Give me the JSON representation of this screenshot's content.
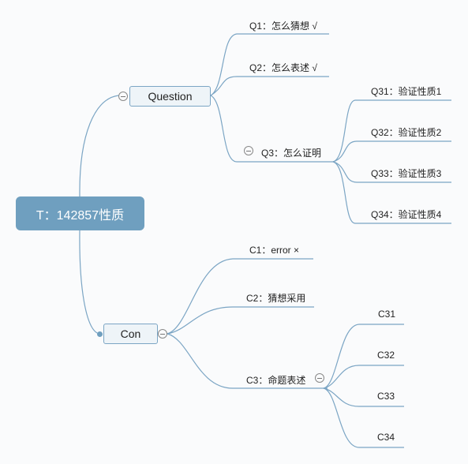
{
  "colors": {
    "line": "#7ba5c4",
    "root_fill": "#6f9fbf",
    "root_text": "#ffffff",
    "node_fill": "#eef4f8",
    "background": "#fafbfc"
  },
  "root": {
    "label": "T：142857性质"
  },
  "branches": {
    "question": {
      "label": "Question",
      "toggle_icon": "collapse-minus-icon",
      "children": [
        {
          "label": "Q1：怎么猜想 √"
        },
        {
          "label": "Q2：怎么表述 √"
        },
        {
          "label": "Q3：怎么证明",
          "toggle_icon": "collapse-minus-icon",
          "children": [
            {
              "label": "Q31：验证性质1"
            },
            {
              "label": "Q32：验证性质2"
            },
            {
              "label": "Q33：验证性质3"
            },
            {
              "label": "Q34：验证性质4"
            }
          ]
        }
      ]
    },
    "con": {
      "label": "Con",
      "toggle_icon": "collapse-minus-icon",
      "children": [
        {
          "label": "C1：error ×"
        },
        {
          "label": "C2：猜想采用"
        },
        {
          "label": "C3：命题表述",
          "toggle_icon": "collapse-minus-icon",
          "children": [
            {
              "label": "C31"
            },
            {
              "label": "C32"
            },
            {
              "label": "C33"
            },
            {
              "label": "C34"
            }
          ]
        }
      ]
    }
  }
}
